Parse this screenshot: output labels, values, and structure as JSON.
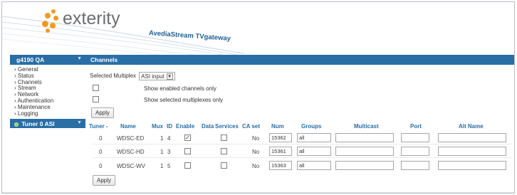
{
  "brand": {
    "logo_text": "exterity",
    "tagline": "AvediaStream TVgateway"
  },
  "colors": {
    "accent": "#2a6ea6",
    "logo_dots": "#f29a1f",
    "active_indicator": "#8bd15b"
  },
  "sidebar": {
    "device_name": "g4190 QA",
    "items": [
      {
        "label": "General"
      },
      {
        "label": "Status"
      },
      {
        "label": "Channels"
      },
      {
        "label": "Stream"
      },
      {
        "label": "Network"
      },
      {
        "label": "Authentication"
      },
      {
        "label": "Maintenance"
      },
      {
        "label": "Logging"
      }
    ],
    "tuner_label": "Tuner 0 ASI"
  },
  "main": {
    "title": "Channels",
    "multiplex_label": "Selected Multiplex",
    "multiplex_value": "ASI input",
    "show_enabled_label": "Show enabled channels only",
    "show_selected_label": "Show selected multiplexes only",
    "apply_label": "Apply",
    "columns": [
      "Tuner -",
      "Name",
      "Mux",
      "ID",
      "Enable",
      "Data",
      "Services",
      "CA set",
      "Num",
      "Groups",
      "Multicast",
      "Port",
      "Alt Name"
    ],
    "rows": [
      {
        "tuner": "0",
        "name": "WDSC-ED",
        "mux": "1",
        "id": "4",
        "enabled": true,
        "data": false,
        "ca_set": "No",
        "num": "15362",
        "groups": "all",
        "multicast": "",
        "port": "",
        "alt_name": ""
      },
      {
        "tuner": "0",
        "name": "WDSC-HD",
        "mux": "1",
        "id": "3",
        "enabled": false,
        "data": false,
        "ca_set": "No",
        "num": "15361",
        "groups": "all",
        "multicast": "",
        "port": "",
        "alt_name": ""
      },
      {
        "tuner": "0",
        "name": "WDSC-WV",
        "mux": "1",
        "id": "5",
        "enabled": false,
        "data": false,
        "ca_set": "No",
        "num": "15363",
        "groups": "all",
        "multicast": "",
        "port": "",
        "alt_name": ""
      }
    ],
    "apply_bottom_label": "Apply"
  }
}
